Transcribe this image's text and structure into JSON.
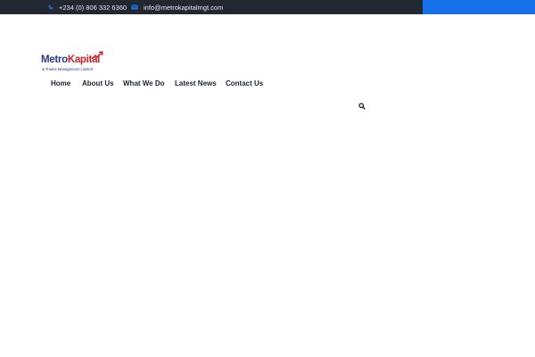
{
  "topbar": {
    "phone": "+234 (0) 806 332 6360",
    "email": "info@metrokapitalmgt.com",
    "phone_icon": "phone-icon",
    "email_icon": "envelope-icon"
  },
  "logo": {
    "word_part1": "Metro",
    "word_part2": "Kapital",
    "subtitle": "& Trades Management Limited"
  },
  "nav": {
    "items": [
      {
        "label": "Home"
      },
      {
        "label": "About Us"
      },
      {
        "label": "What We Do"
      },
      {
        "label": "Latest News"
      },
      {
        "label": "Contact Us"
      }
    ],
    "search_icon": "search-icon"
  },
  "colors": {
    "topbar": "#222832",
    "accent": "#1671e8",
    "brand_blue": "#2a3a86",
    "brand_red": "#c9202b"
  }
}
